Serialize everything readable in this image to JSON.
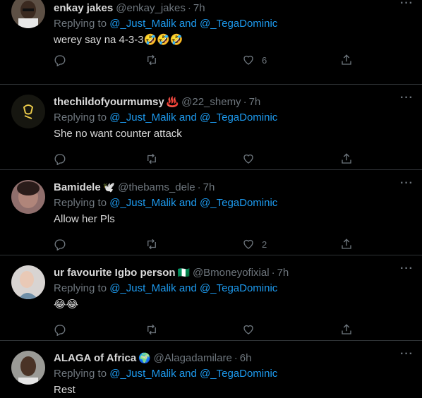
{
  "tweets": [
    {
      "name": "enkay jakes",
      "badge": "",
      "handle": "@enkay_jakes",
      "time": "7h",
      "reply_prefix": "Replying to",
      "mention1": "@_Just_Malik",
      "and": "and",
      "mention2": "@_TegaDominic",
      "text": "werey say na 4-3-3🤣🤣🤣",
      "likes": "6",
      "avatar_color": "#6b5a4a"
    },
    {
      "name": "thechildofyourmumsy",
      "badge": "♨️",
      "handle": "@22_shemy",
      "time": "7h",
      "reply_prefix": "Replying to",
      "mention1": "@_Just_Malik",
      "and": "and",
      "mention2": "@_TegaDominic",
      "text": "She no want counter attack",
      "likes": "",
      "avatar_color": "#1a1a10"
    },
    {
      "name": "Bamidele",
      "badge": "🕊️",
      "handle": "@thebams_dele",
      "time": "7h",
      "reply_prefix": "Replying to",
      "mention1": "@_Just_Malik",
      "and": "and",
      "mention2": "@_TegaDominic",
      "text": "Allow her Pls",
      "likes": "2",
      "avatar_color": "#7a5a5a"
    },
    {
      "name": "ur favourite Igbo person",
      "badge": "🇳🇬",
      "handle": "@Bmoneyofixial",
      "time": "7h",
      "reply_prefix": "Replying to",
      "mention1": "@_Just_Malik",
      "and": "and",
      "mention2": "@_TegaDominic",
      "text": "😂😂",
      "likes": "",
      "avatar_color": "#c9c4c0"
    },
    {
      "name": "ALAGA of Africa",
      "badge": "🌍",
      "handle": "@Alagadamilare",
      "time": "6h",
      "reply_prefix": "Replying to",
      "mention1": "@_Just_Malik",
      "and": "and",
      "mention2": "@_TegaDominic",
      "text": "Rest",
      "likes": "",
      "avatar_color": "#8a8a88"
    }
  ],
  "more_label": "···",
  "colors": {
    "background": "#000000",
    "mention": "#1d9bf0",
    "muted": "#6e767d",
    "divider": "#2f3336"
  },
  "icons": {
    "reply": "reply-icon",
    "retweet": "retweet-icon",
    "like": "heart-icon",
    "share": "share-icon",
    "more": "more-icon"
  }
}
